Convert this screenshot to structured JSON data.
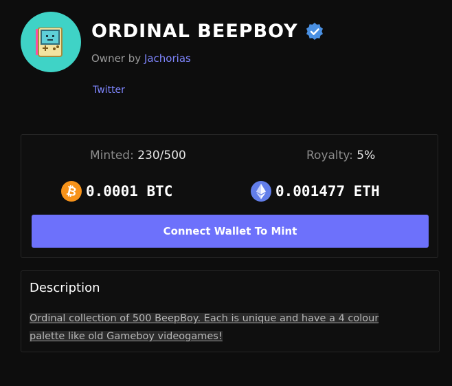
{
  "collection": {
    "title": "ORDINAL BEEPBOY",
    "owner_prefix": "Owner by",
    "owner_name": "Jachorias",
    "twitter_label": "Twitter"
  },
  "stats": {
    "minted_label": "Minted:",
    "minted_value": "230/500",
    "royalty_label": "Royalty:",
    "royalty_value": "5%"
  },
  "prices": {
    "btc": "0.0001 BTC",
    "eth": "0.001477 ETH"
  },
  "mint_button_label": "Connect Wallet To Mint",
  "description": {
    "heading": "Description",
    "text": "Ordinal collection of 500 BeepBoy. Each is unique and have a 4 colour palette like old Gameboy videogames!"
  },
  "colors": {
    "background": "#0d0d0d",
    "accent": "#6d71fb",
    "link": "#7f86ff",
    "avatar_bg": "#3fd3c6",
    "btc": "#f7931a",
    "eth": "#627eea",
    "verified": "#4a90e2"
  },
  "icons": {
    "avatar": "gameboy-avatar-icon",
    "verified": "verified-badge-icon",
    "btc": "bitcoin-icon",
    "eth": "ethereum-icon"
  }
}
